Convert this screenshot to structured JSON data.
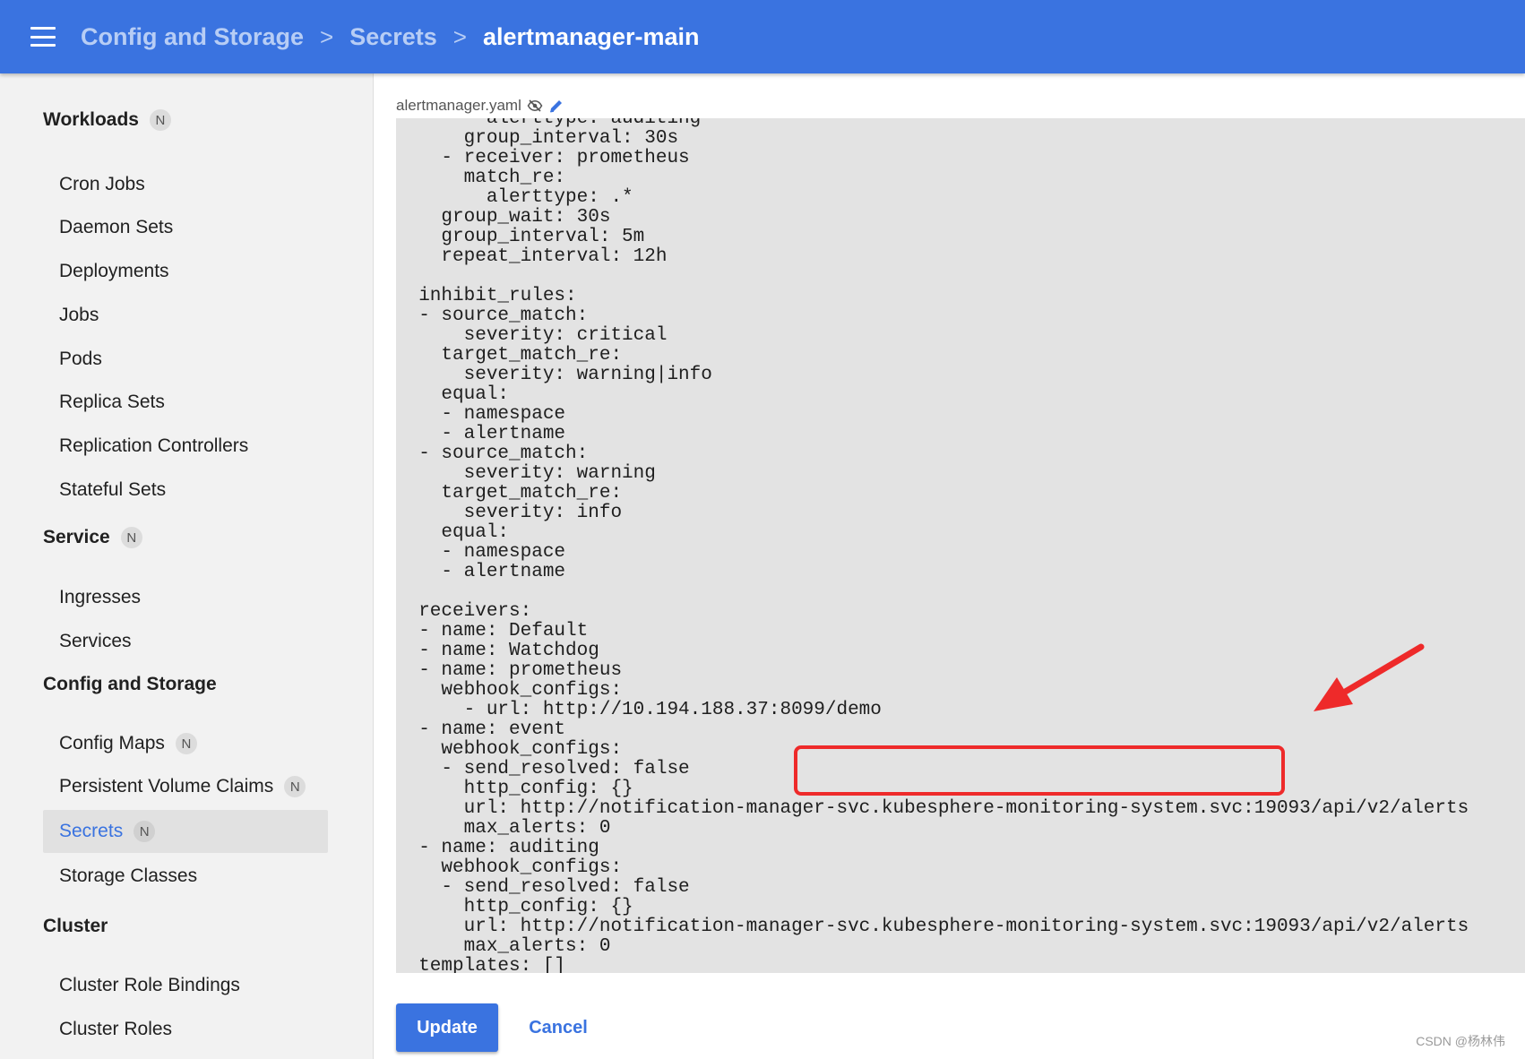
{
  "breadcrumb": {
    "items": [
      "Config and Storage",
      "Secrets"
    ],
    "separator": ">",
    "current": "alertmanager-main"
  },
  "sidebar": {
    "badge": "N",
    "sections": {
      "workloads": "Workloads",
      "service": "Service",
      "config_storage": "Config and Storage",
      "cluster": "Cluster"
    },
    "items": {
      "cron_jobs": "Cron Jobs",
      "daemon_sets": "Daemon Sets",
      "deployments": "Deployments",
      "jobs": "Jobs",
      "pods": "Pods",
      "replica_sets": "Replica Sets",
      "replication_controllers": "Replication Controllers",
      "stateful_sets": "Stateful Sets",
      "ingresses": "Ingresses",
      "services": "Services",
      "config_maps": "Config Maps",
      "pvc": "Persistent Volume Claims",
      "secrets": "Secrets",
      "storage_classes": "Storage Classes",
      "cluster_role_bindings": "Cluster Role Bindings",
      "cluster_roles": "Cluster Roles"
    },
    "active": "Secrets"
  },
  "editor": {
    "file_name": "alertmanager.yaml",
    "lines": [
      "        alerttype: auditing",
      "      group_interval: 30s",
      "    - receiver: prometheus",
      "      match_re:",
      "        alerttype: .*",
      "    group_wait: 30s",
      "    group_interval: 5m",
      "    repeat_interval: 12h",
      "",
      "  inhibit_rules:",
      "  - source_match:",
      "      severity: critical",
      "    target_match_re:",
      "      severity: warning|info",
      "    equal:",
      "    - namespace",
      "    - alertname",
      "  - source_match:",
      "      severity: warning",
      "    target_match_re:",
      "      severity: info",
      "    equal:",
      "    - namespace",
      "    - alertname",
      "",
      "  receivers:",
      "  - name: Default",
      "  - name: Watchdog",
      "  - name: prometheus",
      "    webhook_configs:",
      "      - url: http://10.194.188.37:8099/demo",
      "  - name: event",
      "    webhook_configs:",
      "    - send_resolved: false",
      "      http_config: {}",
      "      url: http://notification-manager-svc.kubesphere-monitoring-system.svc:19093/api/v2/alerts",
      "      max_alerts: 0",
      "  - name: auditing",
      "    webhook_configs:",
      "    - send_resolved: false",
      "      http_config: {}",
      "      url: http://notification-manager-svc.kubesphere-monitoring-system.svc:19093/api/v2/alerts",
      "      max_alerts: 0",
      "  templates: []"
    ]
  },
  "annotation": {
    "box_color": "#ee2a2a",
    "arrow_color": "#ee2a2a"
  },
  "actions": {
    "update": "Update",
    "cancel": "Cancel"
  },
  "watermark": "CSDN @杨林伟",
  "colors": {
    "topbar": "#3a73e0",
    "accent": "#3a73e0",
    "editor_bg": "#e3e3e3",
    "sidebar_bg": "#f2f2f2"
  }
}
